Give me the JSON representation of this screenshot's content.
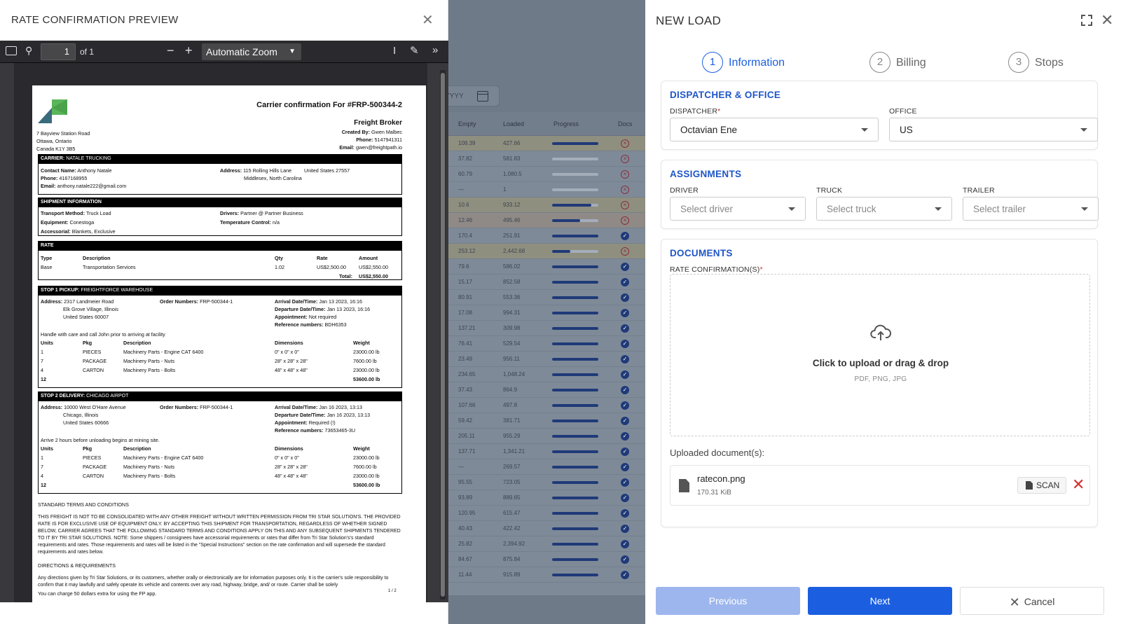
{
  "left_panel": {
    "title": "RATE CONFIRMATION PREVIEW",
    "close_icon": "close-icon",
    "viewer": {
      "page_number": "1",
      "page_total": "of 1",
      "zoom": "Automatic Zoom"
    }
  },
  "doc": {
    "address_lines": [
      "7 Bayview Station Road",
      "Ottawa, Ontario",
      "Canada K1Y 3B5"
    ],
    "heading": "Carrier confirmation For #FRP-500344-2",
    "broker_title": "Freight Broker",
    "created_by_label": "Created By:",
    "created_by": "Gwen Malbec",
    "phone_label": "Phone:",
    "phone": "5147941311",
    "email_label": "Email:",
    "email": "gwen@freightpath.io",
    "carrier_bar": "CARRIER:",
    "carrier_name": "NATALE TRUCKING",
    "contact_label": "Contact Name:",
    "contact": "Anthony Natale",
    "cphone_label": "Phone:",
    "cphone": "4167168955",
    "cemail_label": "Email:",
    "cemail": "anthony.natale222@gmail.com",
    "caddr_label": "Address:",
    "caddr1": "115 Rolling Hills Lane",
    "caddr_country": "United States 27557",
    "caddr2": "Middlesex, North Carolina",
    "shipment_bar": "SHIPMENT INFORMATION",
    "tm_label": "Transport Method:",
    "tm": "Truck Load",
    "eq_label": "Equipment:",
    "eq": "Conestoga",
    "acc_label": "Accessorial:",
    "acc": "Blankets, Exclusive",
    "drv_label": "Drivers:",
    "drv": "Partner @ Partner Business",
    "temp_label": "Temperature Control:",
    "temp": "n/a",
    "rate_bar": "RATE",
    "rate_headers": [
      "Type",
      "Description",
      "Qty",
      "Rate",
      "Amount"
    ],
    "rate_row": [
      "Base",
      "Transportation Services",
      "1.02",
      "US$2,500.00",
      "US$2,550.00"
    ],
    "total_label": "Total:",
    "total": "US$2,550.00",
    "stop1_bar": "STOP 1 PICKUP:",
    "stop1_name": "FREIGHTFORCE WAREHOUSE",
    "stop1_addr_label": "Address:",
    "stop1_addr": [
      "2317 Landmeier Road",
      "Elk Grove Village, Illinois",
      "United States 60007"
    ],
    "order_label": "Order Numbers:",
    "stop1_order": "FRP-500344-1",
    "arr_label": "Arrival Date/Time:",
    "stop1_arr": "Jan 13 2023, 16:16",
    "dep_label": "Departure Date/Time:",
    "stop1_dep": "Jan 13 2023, 16:16",
    "appt_label": "Appointment:",
    "stop1_appt": "Not required",
    "ref_label": "Reference numbers:",
    "stop1_ref": "BDH6353",
    "stop1_note": "Handle with care and call John prior to arriving at facility",
    "item_headers": [
      "Units",
      "Pkg",
      "Description",
      "Dimensions",
      "Weight"
    ],
    "stop1_items": [
      [
        "1",
        "PIECES",
        "Machinery Parts - Engine CAT 6400",
        "0\" x 0\" x 0\"",
        "23000.00 lb"
      ],
      [
        "7",
        "PACKAGE",
        "Machinery Parts - Nuts",
        "28\" x 28\" x 28\"",
        "7600.00 lb"
      ],
      [
        "4",
        "CARTON",
        "Machinery Parts - Bolts",
        "48\" x 48\" x 48\"",
        "23000.00 lb"
      ]
    ],
    "stop1_total_units": "12",
    "stop1_total_weight": "53600.00 lb",
    "stop2_bar": "STOP 2 DELIVERY:",
    "stop2_name": "CHICAGO AIRPOT",
    "stop2_addr": [
      "10000 West O'Hare Avenue",
      "Chicago, Illinois",
      "United States 60666"
    ],
    "stop2_order": "FRP-500344-1",
    "stop2_arr": "Jan 16 2023, 13:13",
    "stop2_dep": "Jan 16 2023, 13:13",
    "stop2_appt": "Required (!)",
    "stop2_ref": "73653465-3U",
    "stop2_note": "Arrive 2 hours before unloading begins at mining site.",
    "stop2_items": [
      [
        "1",
        "PIECES",
        "Machinery Parts - Engine CAT 6400",
        "0\" x 0\" x 0\"",
        "23000.00 lb"
      ],
      [
        "7",
        "PACKAGE",
        "Machinery Parts - Nuts",
        "28\" x 28\" x 28\"",
        "7600.00 lb"
      ],
      [
        "4",
        "CARTON",
        "Machinery Parts - Bolts",
        "48\" x 48\" x 48\"",
        "23000.00 lb"
      ]
    ],
    "stop2_total_units": "12",
    "stop2_total_weight": "53600.00 lb",
    "terms_title": "STANDARD TERMS AND CONDITIONS",
    "terms_body": "THIS FREIGHT IS NOT TO BE CONSOLIDATED WITH ANY OTHER FREIGHT WITHOUT WRITTEN PERMISSION FROM TRI STAR SOLUTION'S. THE PROVIDED RATE IS FOR EXCLUSIVE USE OF EQUIPMENT ONLY. BY ACCEPTING THIS SHIPMENT FOR TRANSPORTATION, REGARDLESS OF WHETHER SIGNED BELOW, CARRIER AGREES THAT THE FOLLOWING STANDARD TERMS AND CONDITIONS APPLY ON THIS AND ANY SUBSEQUENT SHIPMENTS TENDERED TO IT BY TRI STAR SOLUTIONS. NOTE: Some shippers / consignees have accessorial requirements or rates that differ from Tri Star Solution's's standard requirements and rates. Those requirements and rates will be listed in the \"Special Instructions\" section on the rate confirmation and will supersede the standard requirements and rates below.",
    "directions_title": "DIRECTIONS & REQUIREMENTS",
    "directions_body": "Any directions given by Tri Star Solutions, or its customers, whether orally or electronically are for information purposes only. It is the carrier's sole responsibility to confirm that it may lawfully and safely operate its vehicle and contents over any road, highway, bridge, and/ or route. Carrier shall be solely",
    "charge_note": "You can charge 50 dollars extra for using the FP app.",
    "page_marker": "1 / 2"
  },
  "background": {
    "date_placeholder": "YYYY",
    "table_headers": [
      "Empty",
      "Loaded",
      "Progress",
      "Docs"
    ],
    "rows": [
      {
        "empty": "108.39",
        "loaded": "427.66",
        "progress": 1.0,
        "doc": "x",
        "tint": "#8f8f7f"
      },
      {
        "empty": "37.82",
        "loaded": "581.83",
        "progress": 0.0,
        "doc": "x",
        "tint": "#7f8a98"
      },
      {
        "empty": "60.79",
        "loaded": "1,080.5",
        "progress": 0.0,
        "doc": "x",
        "tint": "#7f8a98"
      },
      {
        "empty": "—",
        "loaded": "1",
        "progress": 0.0,
        "doc": "x",
        "tint": "#7f8a98"
      },
      {
        "empty": "10.6",
        "loaded": "933.12",
        "progress": 0.85,
        "doc": "x",
        "tint": "#8f8f7f"
      },
      {
        "empty": "12.46",
        "loaded": "495.46",
        "progress": 0.6,
        "doc": "x",
        "tint": "#8f8a86"
      },
      {
        "empty": "170.4",
        "loaded": "251.91",
        "progress": 1.0,
        "doc": "ok",
        "tint": "#7f8a98"
      },
      {
        "empty": "253.12",
        "loaded": "2,442.68",
        "progress": 0.4,
        "doc": "x",
        "tint": "#8f8f7f"
      },
      {
        "empty": "79.6",
        "loaded": "586.02",
        "progress": 1.0,
        "doc": "ok",
        "tint": "#7f8a98"
      },
      {
        "empty": "15.17",
        "loaded": "852.58",
        "progress": 1.0,
        "doc": "ok",
        "tint": "#7f8a98"
      },
      {
        "empty": "80.91",
        "loaded": "553.36",
        "progress": 1.0,
        "doc": "ok",
        "tint": "#7f8a98"
      },
      {
        "empty": "17.08",
        "loaded": "994.31",
        "progress": 1.0,
        "doc": "ok",
        "tint": "#7f8a98"
      },
      {
        "empty": "137.21",
        "loaded": "309.98",
        "progress": 1.0,
        "doc": "ok",
        "tint": "#7f8a98"
      },
      {
        "empty": "76.41",
        "loaded": "529.54",
        "progress": 1.0,
        "doc": "ok",
        "tint": "#7f8a98"
      },
      {
        "empty": "23.49",
        "loaded": "956.11",
        "progress": 1.0,
        "doc": "ok",
        "tint": "#7f8a98"
      },
      {
        "empty": "234.65",
        "loaded": "1,048.24",
        "progress": 1.0,
        "doc": "ok",
        "tint": "#7f8a98"
      },
      {
        "empty": "37.43",
        "loaded": "864.9",
        "progress": 1.0,
        "doc": "ok",
        "tint": "#7f8a98"
      },
      {
        "empty": "107.66",
        "loaded": "497.8",
        "progress": 1.0,
        "doc": "ok",
        "tint": "#7f8a98"
      },
      {
        "empty": "59.42",
        "loaded": "381.71",
        "progress": 1.0,
        "doc": "ok",
        "tint": "#7f8a98"
      },
      {
        "empty": "205.11",
        "loaded": "955.29",
        "progress": 1.0,
        "doc": "ok",
        "tint": "#7f8a98"
      },
      {
        "empty": "137.71",
        "loaded": "1,341.21",
        "progress": 1.0,
        "doc": "ok",
        "tint": "#7f8a98"
      },
      {
        "empty": "—",
        "loaded": "269.57",
        "progress": 1.0,
        "doc": "ok",
        "tint": "#7f8a98"
      },
      {
        "empty": "95.55",
        "loaded": "723.05",
        "progress": 1.0,
        "doc": "ok",
        "tint": "#7f8a98"
      },
      {
        "empty": "93.89",
        "loaded": "889.65",
        "progress": 1.0,
        "doc": "ok",
        "tint": "#7f8a98"
      },
      {
        "empty": "120.95",
        "loaded": "615.47",
        "progress": 1.0,
        "doc": "ok",
        "tint": "#7f8a98"
      },
      {
        "empty": "40.43",
        "loaded": "422.42",
        "progress": 1.0,
        "doc": "ok",
        "tint": "#7f8a98"
      },
      {
        "empty": "25.82",
        "loaded": "2,394.92",
        "progress": 1.0,
        "doc": "ok",
        "tint": "#7f8a98"
      },
      {
        "empty": "84.67",
        "loaded": "875.84",
        "progress": 1.0,
        "doc": "ok",
        "tint": "#7f8a98"
      },
      {
        "empty": "11.44",
        "loaded": "915.89",
        "progress": 1.0,
        "doc": "ok",
        "tint": "#7f8a98"
      }
    ]
  },
  "new_load": {
    "title": "NEW LOAD",
    "steps": [
      {
        "num": "1",
        "label": "Information",
        "active": true
      },
      {
        "num": "2",
        "label": "Billing",
        "active": false
      },
      {
        "num": "3",
        "label": "Stops",
        "active": false
      }
    ],
    "dispatcher_section": "DISPATCHER & OFFICE",
    "dispatcher_label": "DISPATCHER",
    "dispatcher_value": "Octavian Ene",
    "office_label": "OFFICE",
    "office_value": "US",
    "assignments_section": "ASSIGNMENTS",
    "driver_label": "DRIVER",
    "driver_placeholder": "Select driver",
    "truck_label": "TRUCK",
    "truck_placeholder": "Select truck",
    "trailer_label": "TRAILER",
    "trailer_placeholder": "Select trailer",
    "documents_section": "DOCUMENTS",
    "rate_conf_label": "RATE CONFIRMATION(S)",
    "upload_text": "Click to upload or drag & drop",
    "upload_formats": "PDF, PNG, JPG",
    "uploaded_label": "Uploaded document(s):",
    "file_name": "ratecon.png",
    "file_size": "170.31 KiB",
    "scan_label": "SCAN",
    "previous_label": "Previous",
    "next_label": "Next",
    "cancel_label": "Cancel",
    "required_mark": "*"
  },
  "colors": {
    "accent": "#1b5fe0",
    "required": "#d32f2f",
    "overlay": "#6f7a89"
  }
}
